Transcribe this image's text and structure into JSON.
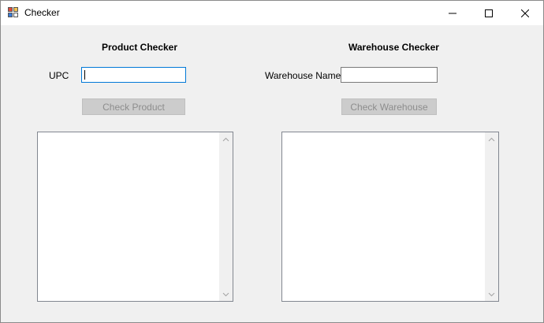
{
  "window": {
    "title": "Checker"
  },
  "product": {
    "heading": "Product Checker",
    "upc_label": "UPC",
    "upc_value": "",
    "check_label": "Check Product"
  },
  "warehouse": {
    "heading": "Warehouse Checker",
    "name_label": "Warehouse Name",
    "name_value": "",
    "check_label": "Check Warehouse"
  },
  "icons": {
    "app": "app-icon",
    "minimize": "minimize-icon",
    "maximize": "maximize-icon",
    "close": "close-icon",
    "scroll_up": "chevron-up-icon",
    "scroll_down": "chevron-down-icon"
  },
  "colors": {
    "client_background": "#f0f0f0",
    "focus_border": "#0078d7",
    "disabled_button": "#cccccc",
    "disabled_text": "#8d8d8d"
  }
}
